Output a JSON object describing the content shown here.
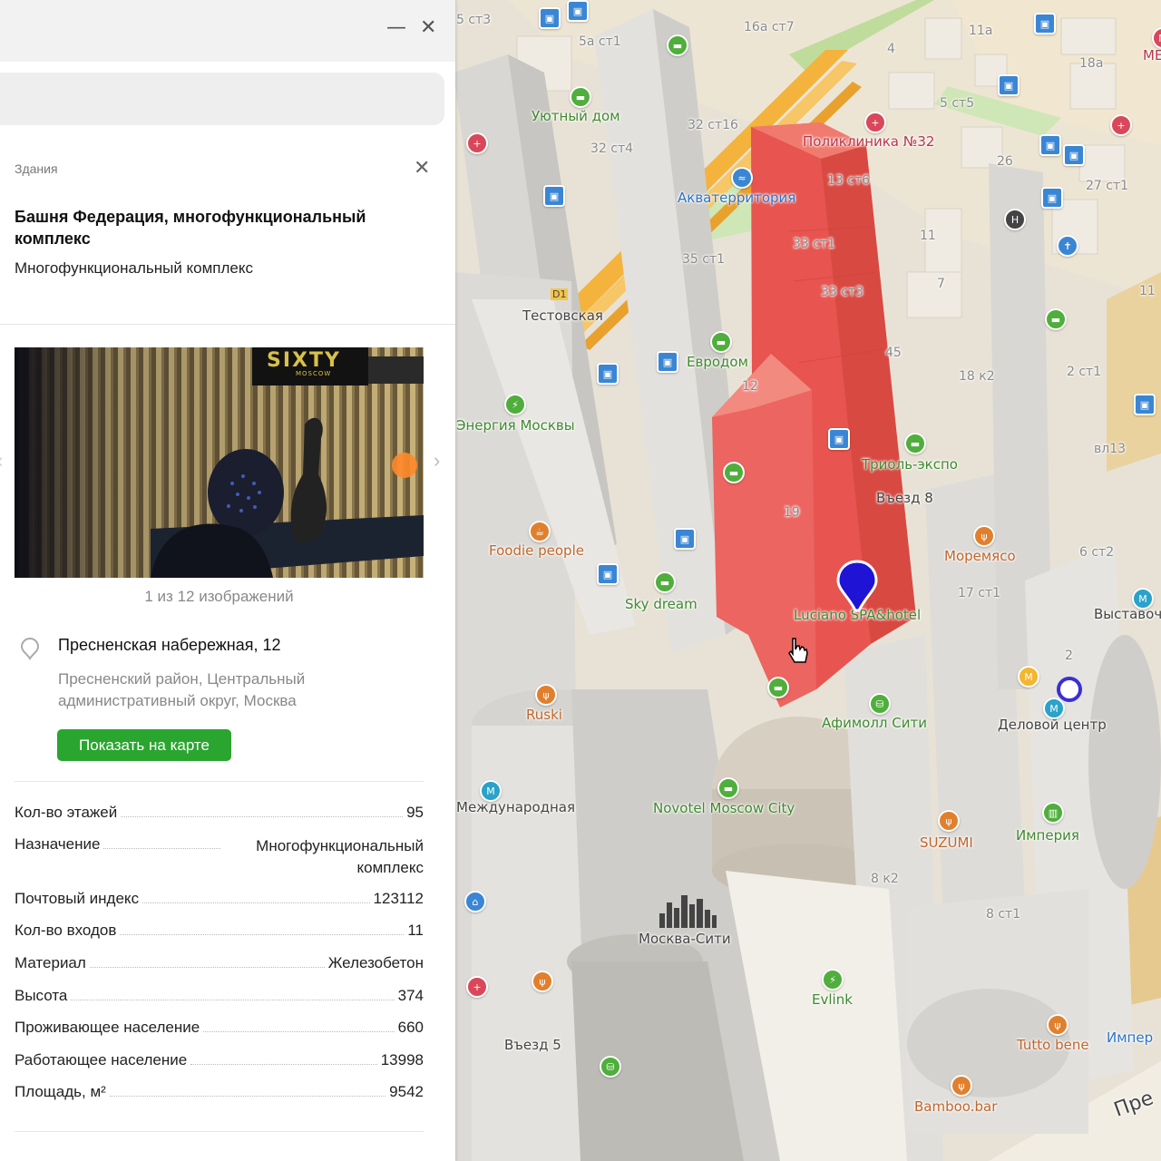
{
  "window": {
    "minimize_label": "—",
    "close_label": "✕"
  },
  "card": {
    "category": "Здания",
    "close_label": "✕",
    "title": "Башня Федерация, многофункциональный комплекс",
    "subtitle": "Многофункциональный комплекс",
    "photo": {
      "counter": "1 из 12 изображений",
      "sign_text": "SIXTY",
      "sign_sub": "MOSCOW",
      "next_label": "›",
      "prev_label": "‹"
    },
    "address": {
      "main": "Пресненская набережная, 12",
      "sub": "Пресненский район, Центральный административный округ, Москва",
      "icon": "location-pin-icon"
    },
    "show_on_map_label": "Показать на карте",
    "attributes": [
      {
        "label": "Кол-во этажей",
        "value": "95"
      },
      {
        "label": "Назначение",
        "value": "Многофункциональный комплекс"
      },
      {
        "label": "Почтовый индекс",
        "value": "123112"
      },
      {
        "label": "Кол-во входов",
        "value": "11"
      },
      {
        "label": "Материал",
        "value": "Железобетон"
      },
      {
        "label": "Высота",
        "value": "374"
      },
      {
        "label": "Проживающее население",
        "value": "660"
      },
      {
        "label": "Работающее население",
        "value": "13998"
      },
      {
        "label": "Площадь, м²",
        "value": "9542"
      }
    ]
  },
  "map": {
    "labels": [
      {
        "text": "5 ст3",
        "cls": "lbl-num"
      },
      {
        "text": "5а ст1",
        "cls": "lbl-num"
      },
      {
        "text": "16а ст7",
        "cls": "lbl-num"
      },
      {
        "text": "11а",
        "cls": "lbl-num"
      },
      {
        "text": "ME",
        "cls": "lbl-red"
      },
      {
        "text": "18а",
        "cls": "lbl-num"
      },
      {
        "text": "4",
        "cls": "lbl-num"
      },
      {
        "text": "Уютный дом",
        "cls": "lbl-green"
      },
      {
        "text": "32 ст16",
        "cls": "lbl-num"
      },
      {
        "text": "5 ст5",
        "cls": "lbl-num"
      },
      {
        "text": "Поликлиника №32",
        "cls": "lbl-red"
      },
      {
        "text": "32 ст4",
        "cls": "lbl-num"
      },
      {
        "text": "26",
        "cls": "lbl-num"
      },
      {
        "text": "13 ст6",
        "cls": "lbl-num"
      },
      {
        "text": "27 ст1",
        "cls": "lbl-num"
      },
      {
        "text": "Акватерритория",
        "cls": "lbl-blue"
      },
      {
        "text": "11",
        "cls": "lbl-num"
      },
      {
        "text": "33 ст1",
        "cls": "lbl-num"
      },
      {
        "text": "35 ст1",
        "cls": "lbl-num"
      },
      {
        "text": "7",
        "cls": "lbl-num"
      },
      {
        "text": "11",
        "cls": "lbl-num"
      },
      {
        "text": "33 ст3",
        "cls": "lbl-num"
      },
      {
        "text": "Тестовская",
        "cls": "lbl-dark"
      },
      {
        "text": "45",
        "cls": "lbl-num"
      },
      {
        "text": "Евродом",
        "cls": "lbl-green"
      },
      {
        "text": "18 к2",
        "cls": "lbl-num"
      },
      {
        "text": "2 ст1",
        "cls": "lbl-num"
      },
      {
        "text": "12",
        "cls": "lbl-num"
      },
      {
        "text": "Энергия Москвы",
        "cls": "lbl-green"
      },
      {
        "text": "вл13",
        "cls": "lbl-num"
      },
      {
        "text": "Триоль-экспо",
        "cls": "lbl-green"
      },
      {
        "text": "Въезд 8",
        "cls": "lbl-dark"
      },
      {
        "text": "19",
        "cls": "lbl-num"
      },
      {
        "text": "Foodie people",
        "cls": "lbl-orange"
      },
      {
        "text": "Моремясо",
        "cls": "lbl-orange"
      },
      {
        "text": "6 ст2",
        "cls": "lbl-num"
      },
      {
        "text": "17 ст1",
        "cls": "lbl-num"
      },
      {
        "text": "Sky dream",
        "cls": "lbl-green"
      },
      {
        "text": "Luciano SPA&hotel",
        "cls": "lbl-green"
      },
      {
        "text": "Выставочная",
        "cls": "lbl-dark"
      },
      {
        "text": "2",
        "cls": "lbl-num"
      },
      {
        "text": "Ruski",
        "cls": "lbl-orange"
      },
      {
        "text": "Афимолл Сити",
        "cls": "lbl-green"
      },
      {
        "text": "Деловой центр",
        "cls": "lbl-dark"
      },
      {
        "text": "Международная",
        "cls": "lbl-dark"
      },
      {
        "text": "Novotel Moscow City",
        "cls": "lbl-green"
      },
      {
        "text": "SUZUMI",
        "cls": "lbl-orange"
      },
      {
        "text": "Империя",
        "cls": "lbl-green"
      },
      {
        "text": "8 к2",
        "cls": "lbl-num"
      },
      {
        "text": "Москва-Сити",
        "cls": "lbl-dark"
      },
      {
        "text": "8 ст1",
        "cls": "lbl-num"
      },
      {
        "text": "Evlink",
        "cls": "lbl-green"
      },
      {
        "text": "Въезд 5",
        "cls": "lbl-dark"
      },
      {
        "text": "Tutto bene",
        "cls": "lbl-orange"
      },
      {
        "text": "Импер",
        "cls": "lbl-blue"
      },
      {
        "text": "Bamboo.bar",
        "cls": "lbl-orange"
      },
      {
        "text": "Пре",
        "cls": "lbl-dark"
      },
      {
        "text": "D1",
        "cls": "lbl-dark"
      }
    ],
    "accent_color": "#e8544f",
    "pin_color": "#1f13d6"
  }
}
